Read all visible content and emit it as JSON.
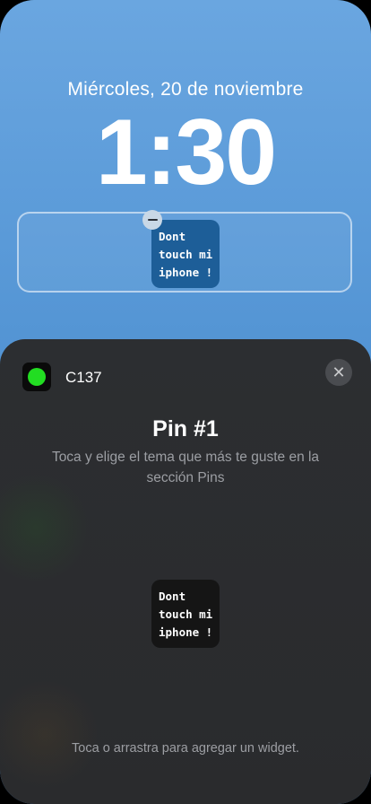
{
  "lock_screen": {
    "date": "Miércoles, 20 de noviembre",
    "time": "1:30",
    "widget_text": "Dont\ntouch mi\niphone !"
  },
  "sheet": {
    "app_name": "C137",
    "app_icon": "green-circle-icon",
    "close_icon": "✕",
    "title": "Pin #1",
    "subtitle": "Toca y elige el tema que más te guste en la sección Pins",
    "preview_text": "Dont\ntouch mi\niphone !",
    "footer_hint": "Toca o arrastra para agregar un widget."
  },
  "colors": {
    "wallpaper_top": "#6aa6e0",
    "wallpaper_bottom": "#3f83c8",
    "placed_widget_bg": "#1d5e98",
    "sheet_bg": "#2c2e31",
    "app_dot": "#22dd22"
  }
}
